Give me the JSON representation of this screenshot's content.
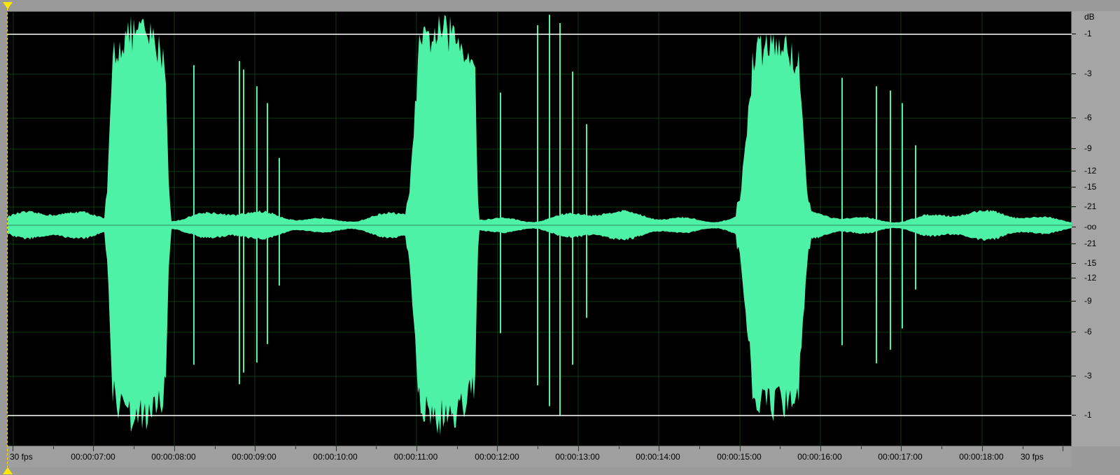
{
  "db_scale": {
    "unit_label": "dB",
    "labels": [
      "-1",
      "-3",
      "-6",
      "-9",
      "-12",
      "-15",
      "-21",
      "-oo",
      "-21",
      "-15",
      "-12",
      "-9",
      "-6",
      "-3",
      "-1"
    ]
  },
  "time_ruler": {
    "start_label": "30 fps",
    "end_label": "30 fps",
    "labels": [
      "00:00:07:00",
      "00:00:08:00",
      "00:00:09:00",
      "00:00:10:00",
      "00:00:11:00",
      "00:00:12:00",
      "00:00:13:00",
      "00:00:14:00",
      "00:00:15:00",
      "00:00:16:00",
      "00:00:17:00",
      "00:00:18:00"
    ]
  },
  "colors": {
    "waveform": "#4ef2a6",
    "background": "#000000",
    "grid": "#0f3a12",
    "clip_line": "#ffffff",
    "marker": "#ffe800"
  },
  "icons": {
    "playhead": "playhead-triangle-icon"
  }
}
